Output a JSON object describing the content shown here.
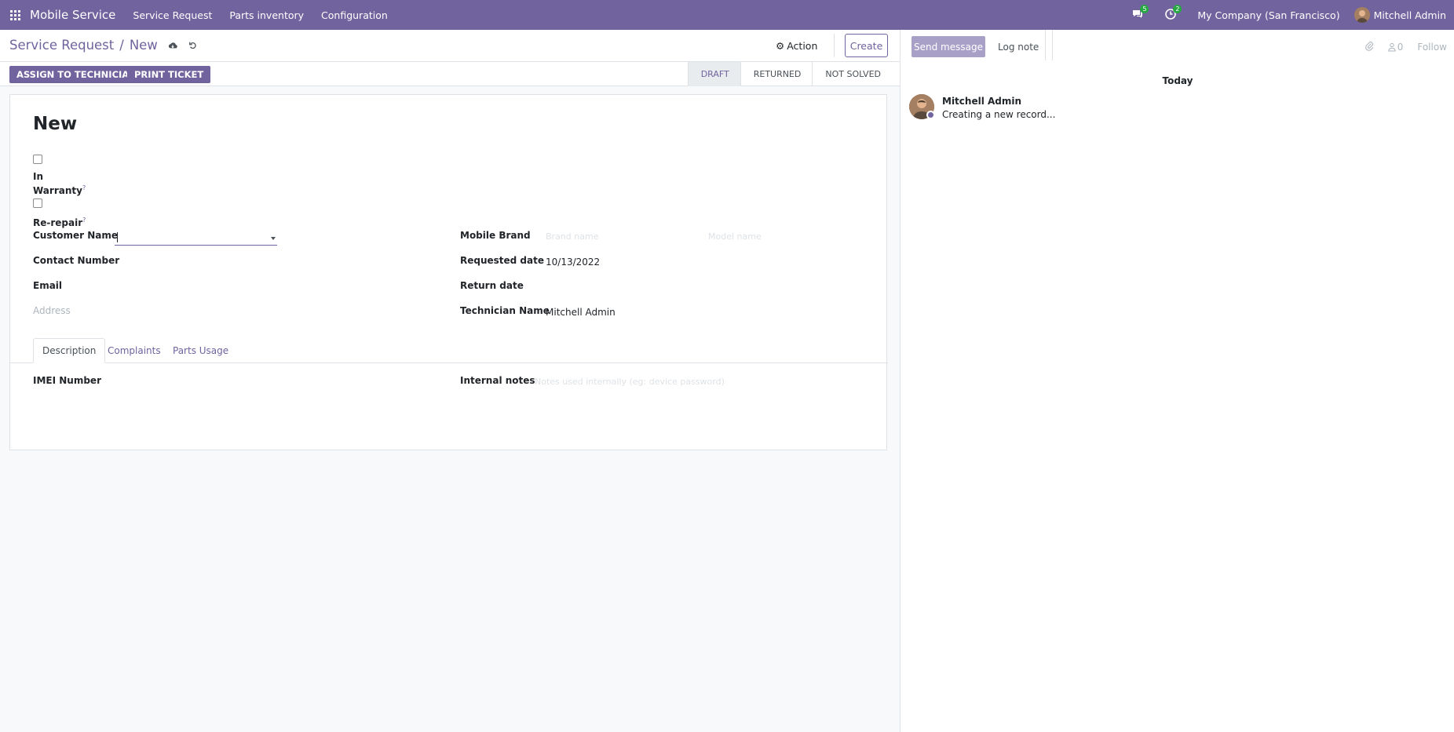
{
  "navbar": {
    "app_name": "Mobile Service",
    "menus": [
      "Service Request",
      "Parts inventory",
      "Configuration"
    ],
    "messages_count": "5",
    "activities_count": "2",
    "company": "My Company (San Francisco)",
    "user": "Mitchell Admin"
  },
  "breadcrumb": {
    "parent": "Service Request",
    "separator": "/",
    "current": "New"
  },
  "toolbar": {
    "action_label": "Action",
    "create_label": "Create"
  },
  "buttons": {
    "assign": "ASSIGN TO TECHNICIAN",
    "print": "PRINT TICKET"
  },
  "stages": [
    "DRAFT",
    "RETURNED",
    "NOT SOLVED"
  ],
  "form": {
    "title": "New",
    "in_label": "In",
    "warranty_label": "Warranty",
    "help_mark": "?",
    "rerepair_label": "Re-repair",
    "customer_name_label": "Customer Name",
    "contact_number_label": "Contact Number",
    "email_label": "Email",
    "address_placeholder": "Address",
    "mobile_brand_label": "Mobile Brand",
    "brand_placeholder": "Brand name",
    "model_placeholder": "Model name",
    "requested_date_label": "Requested date",
    "requested_date_value": "10/13/2022",
    "return_date_label": "Return date",
    "technician_label": "Technician Name",
    "technician_value": "Mitchell Admin",
    "tabs": [
      "Description",
      "Complaints",
      "Parts Usage"
    ],
    "imei_label": "IMEI Number",
    "internal_notes_label": "Internal notes",
    "internal_notes_placeholder": "Notes used internally (eg: device password)"
  },
  "chatter": {
    "send_message": "Send message",
    "log_note": "Log note",
    "attachments_count": "",
    "followers_count": "0",
    "follow_label": "Follow",
    "day_label": "Today",
    "message_author": "Mitchell Admin",
    "message_body": "Creating a new record..."
  },
  "colors": {
    "brand": "#71639e",
    "badge": "#28a745"
  }
}
